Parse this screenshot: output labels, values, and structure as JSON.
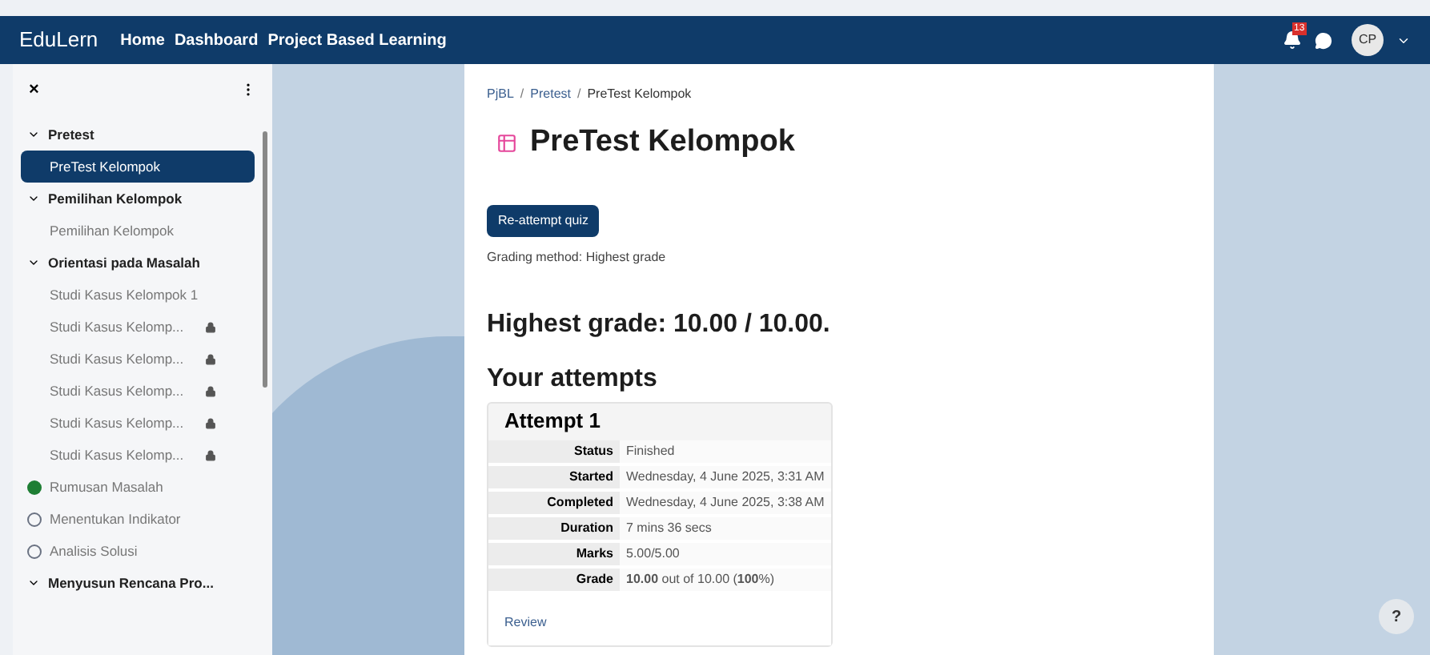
{
  "navbar": {
    "brand": "EduLern",
    "links": [
      "Home",
      "Dashboard",
      "Project Based Learning"
    ],
    "notification_count": "13",
    "avatar": "CP"
  },
  "sidebar": {
    "close": "×",
    "sections": [
      {
        "title": "Pretest",
        "expanded": true,
        "children": [
          {
            "label": "PreTest Kelompok",
            "selected": true,
            "locked": false
          }
        ]
      },
      {
        "title": "Pemilihan Kelompok",
        "expanded": true,
        "children": [
          {
            "label": "Pemilihan Kelompok",
            "selected": false,
            "locked": false
          }
        ]
      },
      {
        "title": "Orientasi pada Masalah",
        "expanded": true,
        "children": [
          {
            "label": "Studi Kasus Kelompok 1",
            "selected": false,
            "locked": false
          },
          {
            "label": "Studi Kasus Kelomp...",
            "selected": false,
            "locked": true
          },
          {
            "label": "Studi Kasus Kelomp...",
            "selected": false,
            "locked": true
          },
          {
            "label": "Studi Kasus Kelomp...",
            "selected": false,
            "locked": true
          },
          {
            "label": "Studi Kasus Kelomp...",
            "selected": false,
            "locked": true
          },
          {
            "label": "Studi Kasus Kelomp...",
            "selected": false,
            "locked": true
          }
        ]
      },
      {
        "children": [
          {
            "label": "Rumusan Masalah",
            "selected": false,
            "locked": false,
            "completed": true
          },
          {
            "label": "Menentukan Indikator",
            "selected": false,
            "locked": false,
            "completed": false
          },
          {
            "label": "Analisis Solusi",
            "selected": false,
            "locked": false,
            "completed": false
          }
        ]
      },
      {
        "title": "Menyusun Rencana Pro...",
        "expanded": true
      }
    ]
  },
  "breadcrumb": {
    "separator": "/",
    "items": [
      "PjBL",
      "Pretest",
      "PreTest Kelompok"
    ]
  },
  "page_title": "PreTest Kelompok",
  "reattempt_button": "Re-attempt quiz",
  "grading_method": "Grading method: Highest grade",
  "highest_grade": "Highest grade: 10.00 / 10.00.",
  "attempts_heading": "Your attempts",
  "attempt": {
    "title": "Attempt 1",
    "rows": [
      {
        "label": "Status",
        "value": "Finished"
      },
      {
        "label": "Started",
        "value": "Wednesday, 4 June 2025, 3:31 AM"
      },
      {
        "label": "Completed",
        "value": "Wednesday, 4 June 2025, 3:38 AM"
      },
      {
        "label": "Duration",
        "value": "7 mins 36 secs"
      },
      {
        "label": "Marks",
        "value": "5.00/5.00"
      },
      {
        "label": "Grade",
        "value": "**10.00** out of 10.00 (**100**%)"
      }
    ],
    "review_link": "Review"
  },
  "help_button": "?"
}
